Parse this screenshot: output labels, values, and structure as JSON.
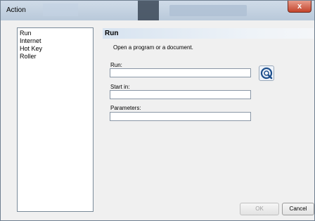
{
  "window": {
    "title": "Action",
    "close_symbol": "x"
  },
  "sidebar": {
    "items": [
      "Run",
      "Internet",
      "Hot Key",
      "Roller"
    ]
  },
  "panel": {
    "title": "Run",
    "description": "Open a program or a document.",
    "run_label": "Run:",
    "run_value": "",
    "start_in_label": "Start in:",
    "start_in_value": "",
    "parameters_label": "Parameters:",
    "parameters_value": ""
  },
  "buttons": {
    "ok": "OK",
    "cancel": "Cancel"
  },
  "colors": {
    "accent": "#1e4f8c",
    "close": "#c4442b"
  }
}
